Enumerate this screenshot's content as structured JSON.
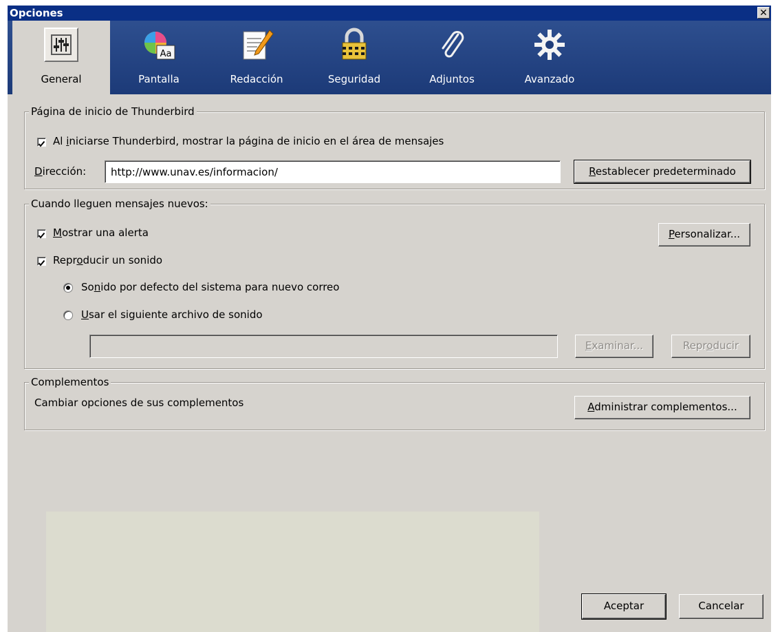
{
  "window": {
    "title": "Opciones",
    "close_label": "✕"
  },
  "tabs": [
    {
      "label": "General",
      "icon": "sliders-icon"
    },
    {
      "label": "Pantalla",
      "icon": "color-font-icon"
    },
    {
      "label": "Redacción",
      "icon": "compose-pencil-icon"
    },
    {
      "label": "Seguridad",
      "icon": "lock-icon"
    },
    {
      "label": "Adjuntos",
      "icon": "paperclip-icon"
    },
    {
      "label": "Avanzado",
      "icon": "gear-icon"
    }
  ],
  "selected_tab": "General",
  "startpage": {
    "legend": "Página de inicio de Thunderbird",
    "show_startpage": {
      "pre": "Al ",
      "key": "i",
      "post": "niciarse Thunderbird, mostrar la página de inicio en el área de mensajes",
      "checked": true
    },
    "address": {
      "key": "D",
      "label_rest": "irección:",
      "value": "http://www.unav.es/informacion/"
    },
    "restore_button": {
      "key": "R",
      "rest": "establecer predeterminado"
    }
  },
  "newmail": {
    "legend": "Cuando lleguen mensajes nuevos:",
    "show_alert": {
      "key": "M",
      "rest": "ostrar una alerta",
      "checked": true
    },
    "customize_button": {
      "key": "P",
      "rest": "ersonalizar..."
    },
    "play_sound": {
      "pre": "Repr",
      "key": "o",
      "post": "ducir un sonido",
      "checked": true
    },
    "sound_default": {
      "pre": "So",
      "key": "n",
      "post": "ido por defecto del sistema para nuevo correo",
      "selected": true
    },
    "sound_file": {
      "key": "U",
      "rest": "sar el siguiente archivo de sonido",
      "selected": false
    },
    "sound_file_value": "",
    "browse_button": {
      "key": "E",
      "rest": "xaminar...",
      "enabled": false
    },
    "play_button": {
      "pre": "Repr",
      "key": "o",
      "post": "ducir",
      "enabled": false
    }
  },
  "addons": {
    "legend": "Complementos",
    "description": "Cambiar opciones de sus complementos",
    "manage_button": {
      "key": "A",
      "rest": "dministrar complementos..."
    }
  },
  "footer": {
    "ok_label": "Aceptar",
    "cancel_label": "Cancelar"
  },
  "colors": {
    "titlebar": "#0a2f85",
    "toolbar": "#1c3a78",
    "dialog": "#d6d3ce"
  }
}
